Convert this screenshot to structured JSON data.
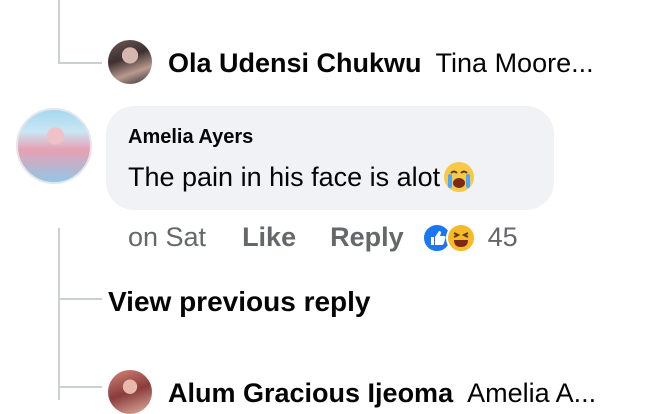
{
  "thread": {
    "reply_1": {
      "author": "Ola Udensi Chukwu",
      "preview": "Tina Moore..."
    },
    "comment": {
      "author": "Amelia Ayers",
      "text": "The pain in his face is alot",
      "emoji": "loudly-crying-face-icon",
      "time": "on Sat",
      "like_label": "Like",
      "reply_label": "Reply",
      "reactions": [
        "like-reaction-icon",
        "haha-reaction-icon"
      ],
      "reaction_count": "45"
    },
    "view_previous_label": "View previous reply",
    "reply_2": {
      "author": "Alum Gracious Ijeoma",
      "preview": "Amelia A..."
    }
  },
  "colors": {
    "thread_line": "#ccd0d5",
    "bubble": "#f0f2f5",
    "meta_text": "#65676b",
    "like_blue": "#1877f2",
    "haha_yellow": "#f7b928"
  }
}
